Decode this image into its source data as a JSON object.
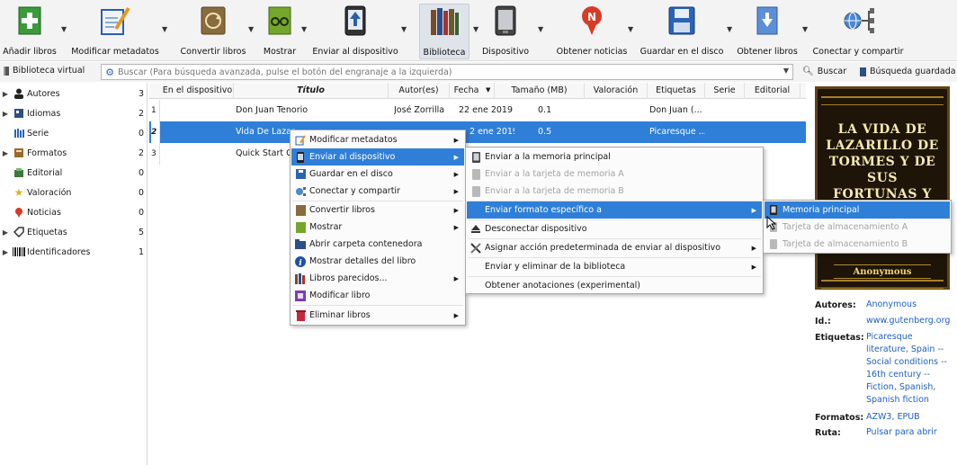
{
  "toolbar": {
    "add_books": "Añadir libros",
    "edit_metadata": "Modificar metadatos",
    "convert": "Convertir libros",
    "view": "Mostrar",
    "send_to_device": "Enviar al dispositivo",
    "library": "Biblioteca",
    "device": "Dispositivo",
    "fetch_news": "Obtener noticias",
    "save_to_disk": "Guardar en el disco",
    "get_books": "Obtener libros",
    "connect_share": "Conectar y compartir"
  },
  "searchbar": {
    "virtual_library": "Biblioteca virtual",
    "placeholder": "Buscar (Para búsqueda avanzada, pulse el botón del engranaje a la izquierda)",
    "search_button": "Buscar",
    "saved_search": "Búsqueda guardada"
  },
  "tag_browser": [
    {
      "name": "Autores",
      "count": "3",
      "icon": "person-icon"
    },
    {
      "name": "Idiomas",
      "count": "2",
      "icon": "languages-icon"
    },
    {
      "name": "Serie",
      "count": "0",
      "icon": "series-icon"
    },
    {
      "name": "Formatos",
      "count": "2",
      "icon": "formats-icon"
    },
    {
      "name": "Editorial",
      "count": "0",
      "icon": "publisher-icon"
    },
    {
      "name": "Valoración",
      "count": "0",
      "icon": "star-icon"
    },
    {
      "name": "Noticias",
      "count": "0",
      "icon": "news-icon"
    },
    {
      "name": "Etiquetas",
      "count": "5",
      "icon": "tag-icon"
    },
    {
      "name": "Identificadores",
      "count": "1",
      "icon": "barcode-icon"
    }
  ],
  "columns": [
    "En el dispositivo",
    "Título",
    "Autor(es)",
    "Fecha",
    "Tamaño (MB)",
    "Valoración",
    "Etiquetas",
    "Serie",
    "Editorial"
  ],
  "books": [
    {
      "num": "1",
      "title": "Don Juan Tenorio",
      "author": "José Zorrilla",
      "date": "22 ene 2019",
      "size": "0.1",
      "tags": "Don Juan (..."
    },
    {
      "num": "2",
      "title": "Vida De Lazar",
      "author": "",
      "date": "2 ene 2019",
      "size": "0.5",
      "tags": "Picaresque ..."
    },
    {
      "num": "3",
      "title": "Quick Start G",
      "author": "",
      "date": "",
      "size": "",
      "tags": ""
    }
  ],
  "context_menu": [
    {
      "label": "Modificar metadatos",
      "icon": "edit-metadata-icon",
      "sub": true
    },
    {
      "label": "Enviar al dispositivo",
      "icon": "send-device-icon",
      "sub": true,
      "highlight": true
    },
    {
      "label": "Guardar en el disco",
      "icon": "save-icon",
      "sub": true
    },
    {
      "label": "Conectar y compartir",
      "icon": "connect-icon",
      "sub": true
    },
    {
      "label": "Convertir libros",
      "icon": "convert-icon",
      "sub": true
    },
    {
      "label": "Mostrar",
      "icon": "view-icon",
      "sub": true
    },
    {
      "label": "Abrir carpeta contenedora",
      "icon": "folder-icon",
      "sub": false
    },
    {
      "label": "Mostrar detalles del libro",
      "icon": "info-icon",
      "sub": false
    },
    {
      "label": "Libros parecidos...",
      "icon": "similar-books-icon",
      "sub": true
    },
    {
      "label": "Modificar libro",
      "icon": "edit-book-icon",
      "sub": false
    },
    {
      "label": "Eliminar libros",
      "icon": "delete-icon",
      "sub": true
    }
  ],
  "send_menu": [
    {
      "label": "Enviar a la memoria principal",
      "icon": "device-icon",
      "sub": false,
      "disabled": false
    },
    {
      "label": "Enviar a la tarjeta de memoria A",
      "icon": "card-icon",
      "sub": false,
      "disabled": true
    },
    {
      "label": "Enviar a la tarjeta de memoria B",
      "icon": "card-icon",
      "sub": false,
      "disabled": true
    },
    {
      "label": "Enviar formato específico a",
      "icon": "",
      "sub": true,
      "highlight": true
    },
    {
      "label": "Desconectar dispositivo",
      "icon": "eject-icon",
      "sub": false
    },
    {
      "label": "Asignar acción predeterminada de enviar al dispositivo",
      "icon": "tools-icon",
      "sub": true
    },
    {
      "label": "Enviar y eliminar de la biblioteca",
      "icon": "",
      "sub": true
    },
    {
      "label": "Obtener anotaciones (experimental)",
      "icon": "",
      "sub": false
    }
  ],
  "format_menu": [
    {
      "label": "Memoria principal",
      "highlight": true
    },
    {
      "label": "Tarjeta de almacenamiento A",
      "disabled": true
    },
    {
      "label": "Tarjeta de almacenamiento B",
      "disabled": true
    }
  ],
  "details": {
    "cover_title": "LA VIDA DE LAZARILLO DE TORMES Y DE SUS FORTUNAS Y",
    "cover_author": "Anonymous",
    "authors_label": "Autores:",
    "authors_value": "Anonymous",
    "id_label": "Id.:",
    "id_value": "www.gutenberg.org",
    "tags_label": "Etiquetas:",
    "tags_value": "Picaresque literature, Spain -- Social conditions -- 16th century -- Fiction, Spanish, Spanish fiction",
    "formats_label": "Formatos:",
    "formats_value": "AZW3, EPUB",
    "path_label": "Ruta:",
    "path_value": "Pulsar para abrir"
  },
  "colors": {
    "selection": "#2f7fd8",
    "link": "#1f5fbf"
  }
}
